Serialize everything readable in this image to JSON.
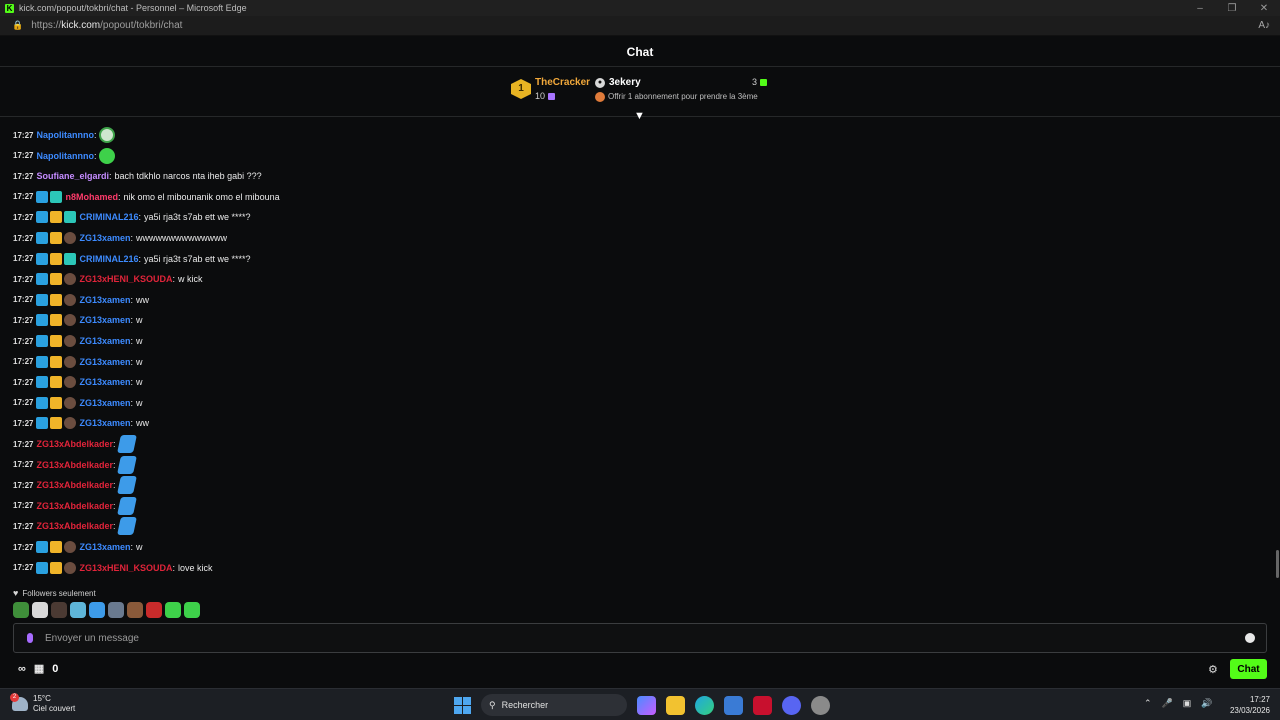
{
  "browser": {
    "title": "kick.com/popout/tokbri/chat - Personnel – Microsoft Edge",
    "url_prefix": "https://",
    "url_domain": "kick.com",
    "url_path": "/popout/tokbri/chat"
  },
  "chat": {
    "header": "Chat",
    "leaderboard": {
      "rank": "1",
      "top_user": "TheCracker",
      "top_count": "10",
      "second_user": "3ekery",
      "second_count": "3",
      "offer_text": "Offrir 1 abonnement pour prendre la 3ème"
    },
    "messages": [
      {
        "time": "17:27",
        "user": "Napolitannno",
        "color": "#3d8bff",
        "text": "",
        "emote": "ghost",
        "badges": []
      },
      {
        "time": "17:27",
        "user": "Napolitannno",
        "color": "#3d8bff",
        "text": "",
        "emote": "green",
        "badges": []
      },
      {
        "time": "17:27",
        "user": "Soufiane_elgardi",
        "color": "#c58cff",
        "text": "bach tdkhlo narcos nta iheb gabi ???",
        "emote": "",
        "badges": []
      },
      {
        "time": "17:27",
        "user": "n8Mohamed",
        "color": "#ff3b6b",
        "text": "nik omo el mibounanik omo el mibouna",
        "emote": "",
        "badges": [
          "vip",
          "sub"
        ]
      },
      {
        "time": "17:27",
        "user": "CRIMINAL216",
        "color": "#3d8bff",
        "text": "ya5i rja3t s7ab ett we ****?",
        "emote": "",
        "badges": [
          "vip",
          "crown",
          "sub"
        ]
      },
      {
        "time": "17:27",
        "user": "ZG13xamen",
        "color": "#3d8bff",
        "text": "wwwwwwwwwwwwww",
        "emote": "",
        "badges": [
          "vip",
          "crown",
          "avatar"
        ]
      },
      {
        "time": "17:27",
        "user": "CRIMINAL216",
        "color": "#3d8bff",
        "text": "ya5i rja3t s7ab ett we ****?",
        "emote": "",
        "badges": [
          "vip",
          "crown",
          "sub"
        ]
      },
      {
        "time": "17:27",
        "user": "ZG13xHENI_KSOUDA",
        "color": "#e1243a",
        "text": "w kick",
        "emote": "",
        "badges": [
          "vip",
          "crown",
          "avatar"
        ]
      },
      {
        "time": "17:27",
        "user": "ZG13xamen",
        "color": "#3d8bff",
        "text": "ww",
        "emote": "",
        "badges": [
          "vip",
          "crown",
          "avatar"
        ]
      },
      {
        "time": "17:27",
        "user": "ZG13xamen",
        "color": "#3d8bff",
        "text": "w",
        "emote": "",
        "badges": [
          "vip",
          "crown",
          "avatar"
        ]
      },
      {
        "time": "17:27",
        "user": "ZG13xamen",
        "color": "#3d8bff",
        "text": "w",
        "emote": "",
        "badges": [
          "vip",
          "crown",
          "avatar"
        ]
      },
      {
        "time": "17:27",
        "user": "ZG13xamen",
        "color": "#3d8bff",
        "text": "w",
        "emote": "",
        "badges": [
          "vip",
          "crown",
          "avatar"
        ]
      },
      {
        "time": "17:27",
        "user": "ZG13xamen",
        "color": "#3d8bff",
        "text": "w",
        "emote": "",
        "badges": [
          "vip",
          "crown",
          "avatar"
        ]
      },
      {
        "time": "17:27",
        "user": "ZG13xamen",
        "color": "#3d8bff",
        "text": "w",
        "emote": "",
        "badges": [
          "vip",
          "crown",
          "avatar"
        ]
      },
      {
        "time": "17:27",
        "user": "ZG13xamen",
        "color": "#3d8bff",
        "text": "ww",
        "emote": "",
        "badges": [
          "vip",
          "crown",
          "avatar"
        ]
      },
      {
        "time": "17:27",
        "user": "ZG13xAbdelkader",
        "color": "#e1243a",
        "text": "",
        "emote": "butterfly",
        "badges": []
      },
      {
        "time": "17:27",
        "user": "ZG13xAbdelkader",
        "color": "#e1243a",
        "text": "",
        "emote": "butterfly",
        "badges": []
      },
      {
        "time": "17:27",
        "user": "ZG13xAbdelkader",
        "color": "#e1243a",
        "text": "",
        "emote": "butterfly",
        "badges": []
      },
      {
        "time": "17:27",
        "user": "ZG13xAbdelkader",
        "color": "#e1243a",
        "text": "",
        "emote": "butterfly",
        "badges": []
      },
      {
        "time": "17:27",
        "user": "ZG13xAbdelkader",
        "color": "#e1243a",
        "text": "",
        "emote": "butterfly",
        "badges": []
      },
      {
        "time": "17:27",
        "user": "ZG13xamen",
        "color": "#3d8bff",
        "text": "w",
        "emote": "",
        "badges": [
          "vip",
          "crown",
          "avatar"
        ]
      },
      {
        "time": "17:27",
        "user": "ZG13xHENI_KSOUDA",
        "color": "#e1243a",
        "text": "love kick",
        "emote": "",
        "badges": [
          "vip",
          "crown",
          "avatar"
        ]
      }
    ],
    "followers_only": "Followers seulement",
    "quick_emotes": [
      "#3f8f3a",
      "#d8d8d8",
      "#4b3a33",
      "#5fb6d9",
      "#3d9be9",
      "#6a7a8f",
      "#8a5a3a",
      "#c92b2b",
      "#3ed14a",
      "#3ed14a"
    ],
    "input_placeholder": "Envoyer un message",
    "points_value": "0",
    "chat_button": "Chat"
  },
  "taskbar": {
    "weather_temp": "15°C",
    "weather_desc": "Ciel couvert",
    "weather_badge": "2",
    "search_label": "Rechercher",
    "time": "17:27",
    "date": "23/03/2026"
  },
  "colors": {
    "accent": "#53fc18",
    "background": "#0b0c0d"
  }
}
